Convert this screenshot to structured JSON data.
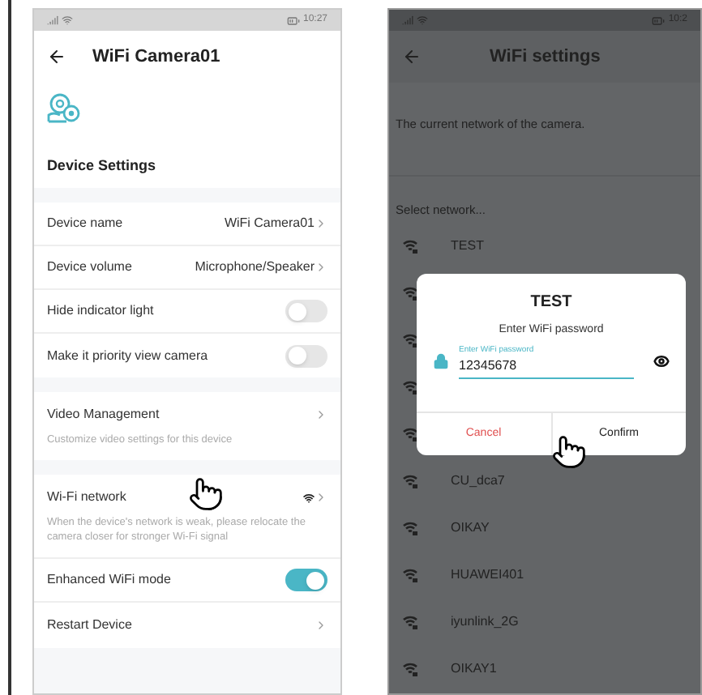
{
  "left_screen": {
    "status_bar": {
      "time": "10:27"
    },
    "title": "WiFi Camera01",
    "section_title": "Device Settings",
    "groups": [
      [
        {
          "kind": "value",
          "label": "Device name",
          "value": "WiFi Camera01"
        },
        {
          "kind": "value",
          "label": "Device volume",
          "value": "Microphone/Speaker"
        },
        {
          "kind": "toggle",
          "label": "Hide indicator light",
          "on": false
        },
        {
          "kind": "toggle",
          "label": "Make it priority view camera",
          "on": false
        }
      ],
      [
        {
          "kind": "link",
          "label": "Video Management",
          "description": "Customize video settings for this device"
        }
      ],
      [
        {
          "kind": "wifi",
          "label": "Wi-Fi network",
          "description": "When the device's network is weak, please relocate the camera closer for stronger Wi-Fi signal"
        },
        {
          "kind": "toggle",
          "label": "Enhanced WiFi mode",
          "on": true
        },
        {
          "kind": "link",
          "label": "Restart Device"
        }
      ]
    ]
  },
  "right_screen": {
    "status_bar": {
      "time": "10:2"
    },
    "title": "WiFi settings",
    "current_network_label": "The current network of the camera.",
    "select_label": "Select network...",
    "networks": [
      {
        "name": "TEST"
      },
      {
        "name": "CU_dca7"
      },
      {
        "name": "OIKAY"
      },
      {
        "name": "HUAWEI401"
      },
      {
        "name": "iyunlink_2G"
      },
      {
        "name": "OIKAY1"
      }
    ],
    "dialog": {
      "title": "TEST",
      "prompt": "Enter WiFi password",
      "field_label": "Enter WiFi password",
      "value": "12345678",
      "cancel": "Cancel",
      "confirm": "Confirm"
    }
  }
}
